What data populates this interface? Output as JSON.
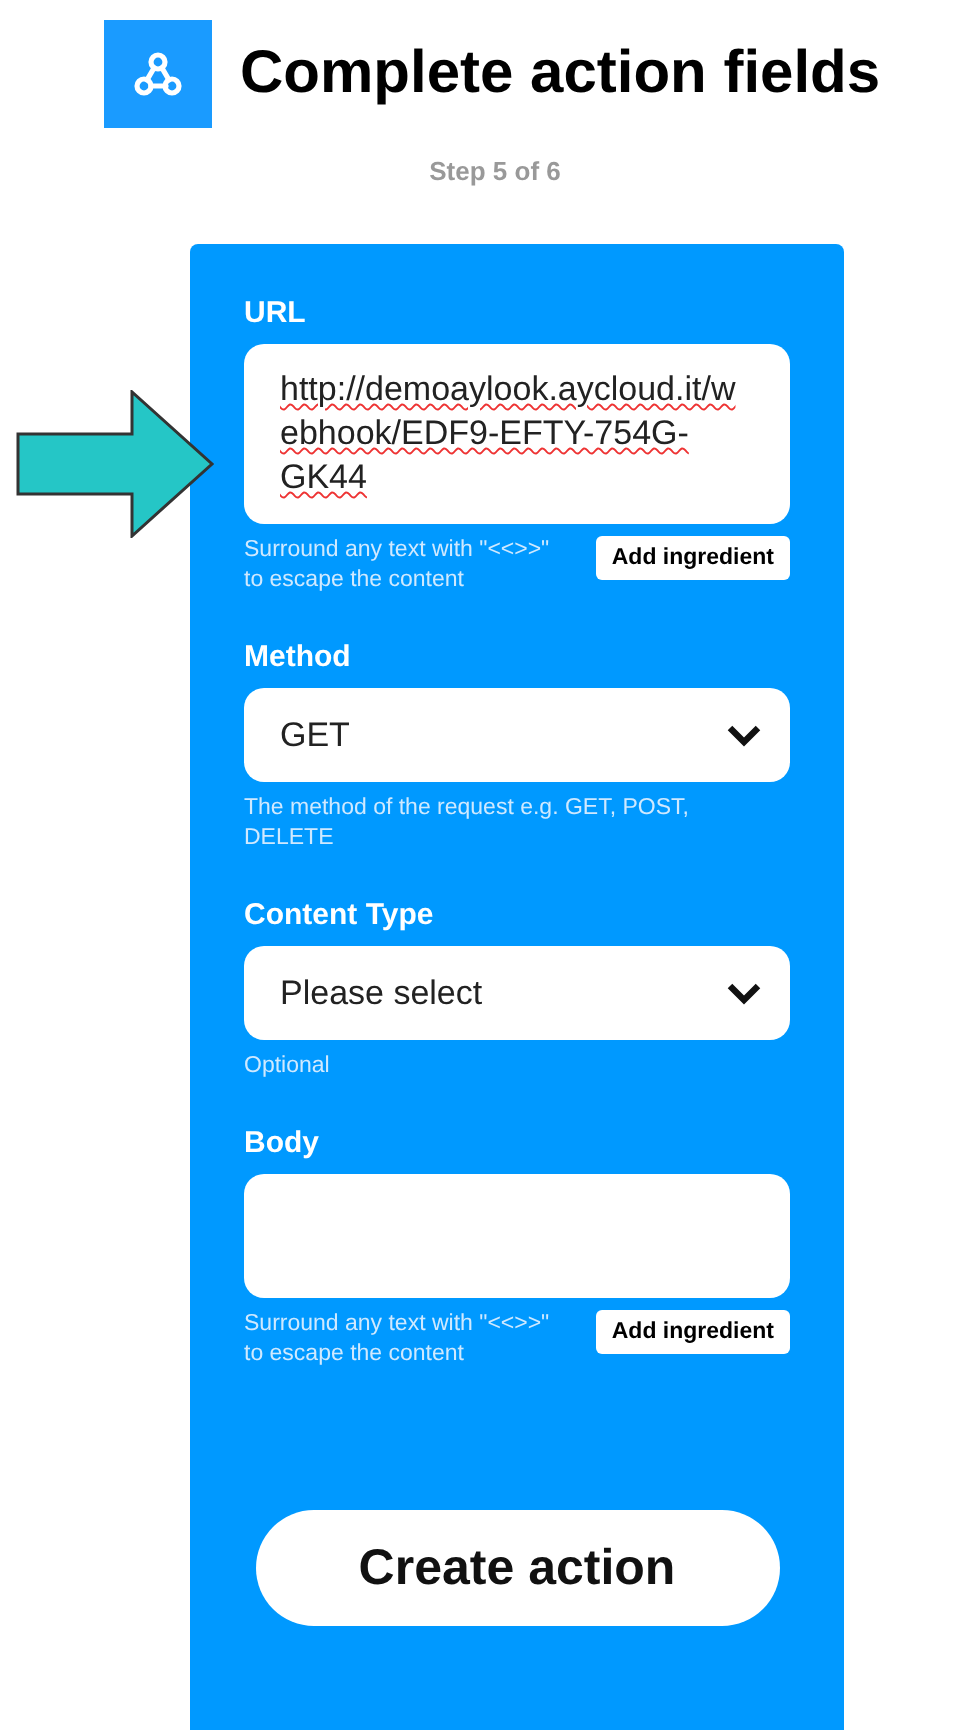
{
  "header": {
    "title": "Complete action fields",
    "step": "Step 5 of 6"
  },
  "fields": [
    {
      "kind": "text",
      "label": "URL",
      "value": "http://demoaylook.aycloud.it/webhook/EDF9-EFTY-754G-GK44",
      "helper": "Surround any text with \"<<>>\" to escape the content",
      "button": "Add ingredient"
    },
    {
      "kind": "select",
      "label": "Method",
      "value": "GET",
      "helper": "The method of the request e.g. GET, POST, DELETE"
    },
    {
      "kind": "select",
      "label": "Content Type",
      "value": "Please select",
      "helper": "Optional"
    },
    {
      "kind": "text",
      "label": "Body",
      "helper": "Surround any text with \"<<>>\" to escape the content",
      "button": "Add ingredient"
    }
  ],
  "submit": "Create action"
}
